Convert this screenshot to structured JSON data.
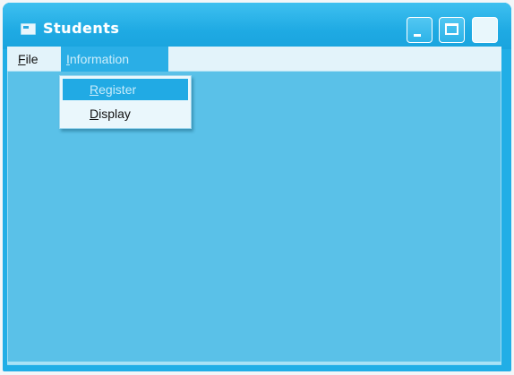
{
  "window": {
    "title": "Students",
    "icons": {
      "app": "window-app-icon",
      "minimize": "minimize-icon",
      "maximize": "maximize-icon",
      "close": "close-icon"
    }
  },
  "menubar": {
    "items": [
      {
        "label": "File",
        "mnemonic": "F",
        "rest": "ile"
      },
      {
        "label": "Information",
        "mnemonic": "I",
        "rest": "nformation",
        "state": "open"
      }
    ]
  },
  "dropdown": {
    "items": [
      {
        "label": "Register",
        "mnemonic": "R",
        "rest": "egister",
        "state": "highlighted"
      },
      {
        "label": "Display",
        "mnemonic": "D",
        "rest": "isplay"
      }
    ]
  },
  "colors": {
    "titlebar": "#21aee6",
    "client": "#5ac1e8",
    "menu_highlight": "#21aae4",
    "menubar": "#e3f3fa"
  }
}
